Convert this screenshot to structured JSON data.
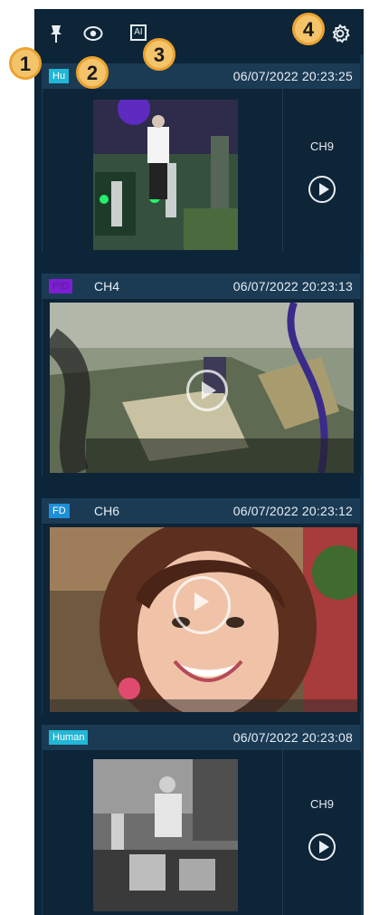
{
  "toolbar": {
    "icons": [
      "pin-icon",
      "eye-icon",
      "ai-icon",
      "gear-icon"
    ],
    "ai_label": "AI"
  },
  "markers": [
    "1",
    "2",
    "3",
    "4"
  ],
  "cards": [
    {
      "badge": "Human",
      "badge_shown": "Hu",
      "channel": "CH9",
      "timestamp": "06/07/2022 20:23:25",
      "layout": "thumb"
    },
    {
      "badge": "PID",
      "channel": "CH4",
      "timestamp": "06/07/2022 20:23:13",
      "layout": "full"
    },
    {
      "badge": "FD",
      "channel": "CH6",
      "timestamp": "06/07/2022 20:23:12",
      "layout": "full"
    },
    {
      "badge": "Human",
      "channel": "CH9",
      "timestamp": "06/07/2022 20:23:08",
      "layout": "thumb"
    }
  ],
  "colors": {
    "panel": "#0c2538",
    "card_header": "#1b3b55",
    "human_badge": "#22b7d6",
    "pid_badge": "#7c1fd1",
    "fd_badge": "#1d8fd8",
    "marker": "#f4c46b"
  }
}
